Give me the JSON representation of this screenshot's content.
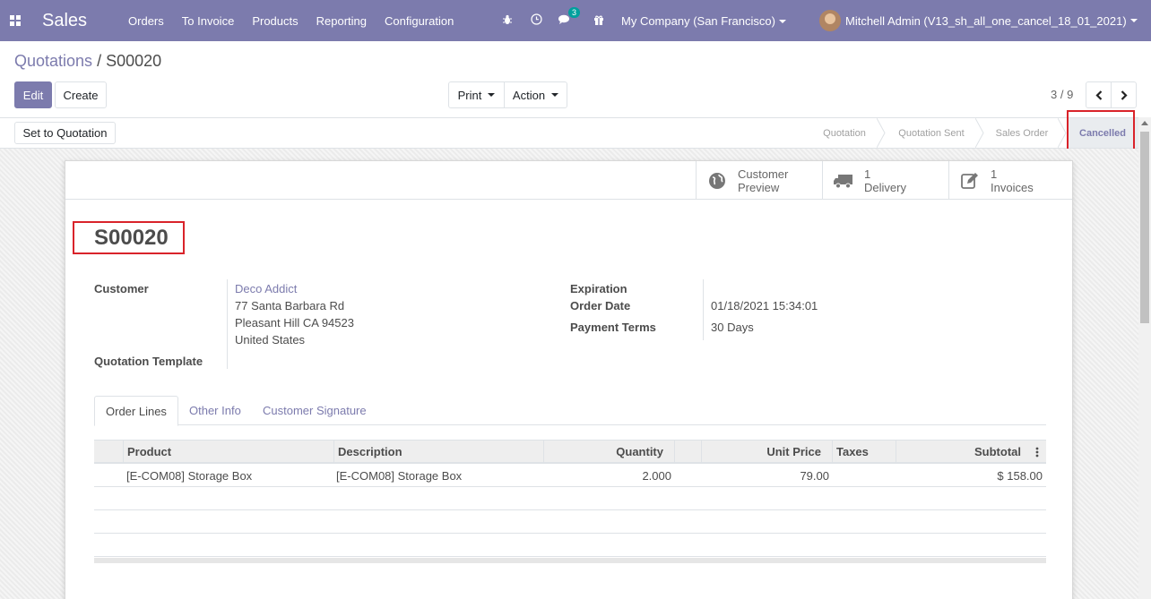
{
  "navbar": {
    "brand": "Sales",
    "menu": [
      "Orders",
      "To Invoice",
      "Products",
      "Reporting",
      "Configuration"
    ],
    "messages_badge": "3",
    "company": "My Company (San Francisco)",
    "user": "Mitchell Admin (V13_sh_all_one_cancel_18_01_2021)"
  },
  "breadcrumb": {
    "parent": "Quotations",
    "separator": " / ",
    "current": "S00020"
  },
  "controls": {
    "edit": "Edit",
    "create": "Create",
    "print": "Print",
    "action": "Action",
    "pager": "3 / 9"
  },
  "statusbar": {
    "set_to_quotation": "Set to Quotation",
    "stages": [
      "Quotation",
      "Quotation Sent",
      "Sales Order",
      "Cancelled"
    ],
    "active_stage": "Cancelled"
  },
  "smart_buttons": {
    "preview_line1": "Customer",
    "preview_line2": "Preview",
    "delivery_count": "1",
    "delivery_label": "Delivery",
    "invoices_count": "1",
    "invoices_label": "Invoices"
  },
  "order": {
    "name": "S00020",
    "customer_label": "Customer",
    "customer_name": "Deco Addict",
    "address_line1": "77 Santa Barbara Rd",
    "address_line2": "Pleasant Hill CA 94523",
    "address_line3": "United States",
    "template_label": "Quotation Template",
    "expiration_label": "Expiration",
    "order_date_label": "Order Date",
    "order_date": "01/18/2021 15:34:01",
    "payment_terms_label": "Payment Terms",
    "payment_terms": "30 Days"
  },
  "tabs": [
    "Order Lines",
    "Other Info",
    "Customer Signature"
  ],
  "table": {
    "headers": {
      "product": "Product",
      "description": "Description",
      "quantity": "Quantity",
      "unit_price": "Unit Price",
      "taxes": "Taxes",
      "subtotal": "Subtotal"
    },
    "rows": [
      {
        "product": "[E-COM08] Storage Box",
        "description": "[E-COM08] Storage Box",
        "quantity": "2.000",
        "unit_price": "79.00",
        "taxes": "",
        "subtotal": "$ 158.00"
      }
    ]
  },
  "colors": {
    "brand": "#7c7bad",
    "highlight": "#d9232a"
  }
}
